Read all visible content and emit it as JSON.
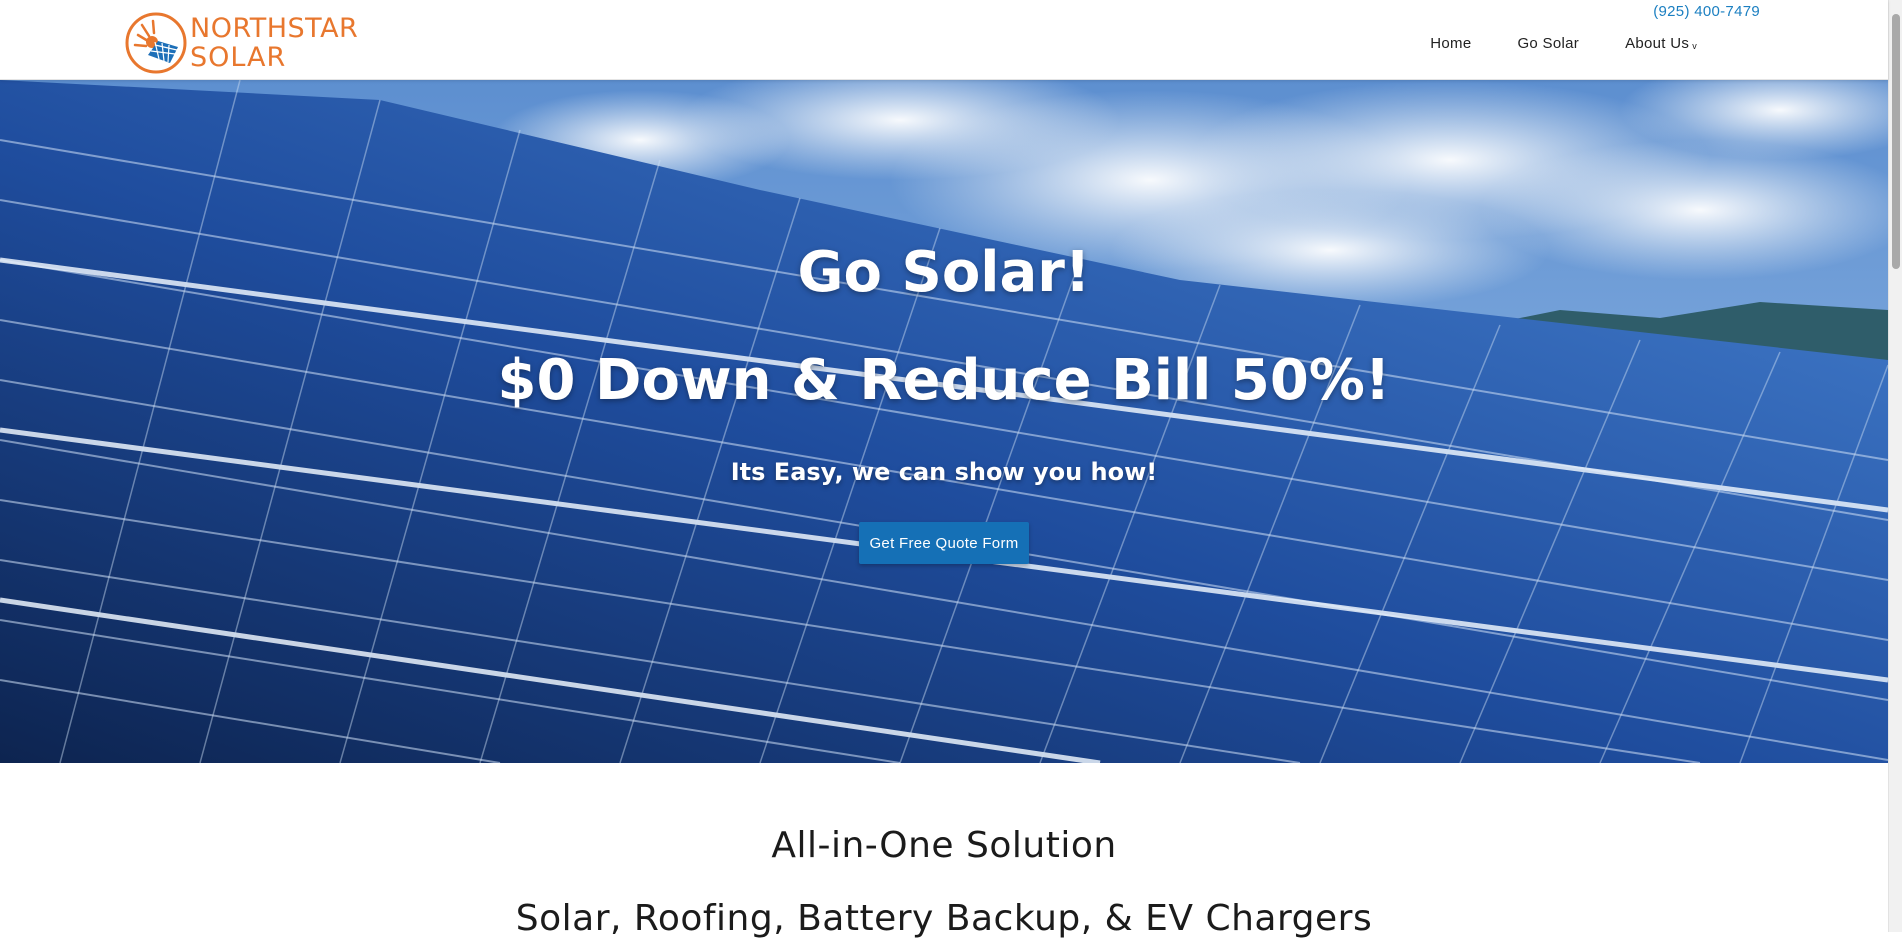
{
  "brand": {
    "name_line1": "NORTHSTAR",
    "name_line2": "SOLAR",
    "logo_icon": "sun-over-solar-panel-icon",
    "accent_color": "#e8772e",
    "panel_color": "#1d6fb8"
  },
  "header": {
    "phone": "(925) 400-7479",
    "nav": [
      {
        "label": "Home"
      },
      {
        "label": "Go Solar"
      },
      {
        "label": "About Us",
        "has_dropdown": true,
        "caret": "v"
      }
    ]
  },
  "hero": {
    "title": "Go Solar!",
    "subtitle": "$0 Down & Reduce Bill 50%!",
    "tagline": "Its Easy, we can show you how!",
    "cta_label": "Get Free Quote Form",
    "cta_color": "#1570b6"
  },
  "section": {
    "title": "All-in-One Solution",
    "subtitle": "Solar, Roofing, Battery Backup, & EV Chargers"
  }
}
